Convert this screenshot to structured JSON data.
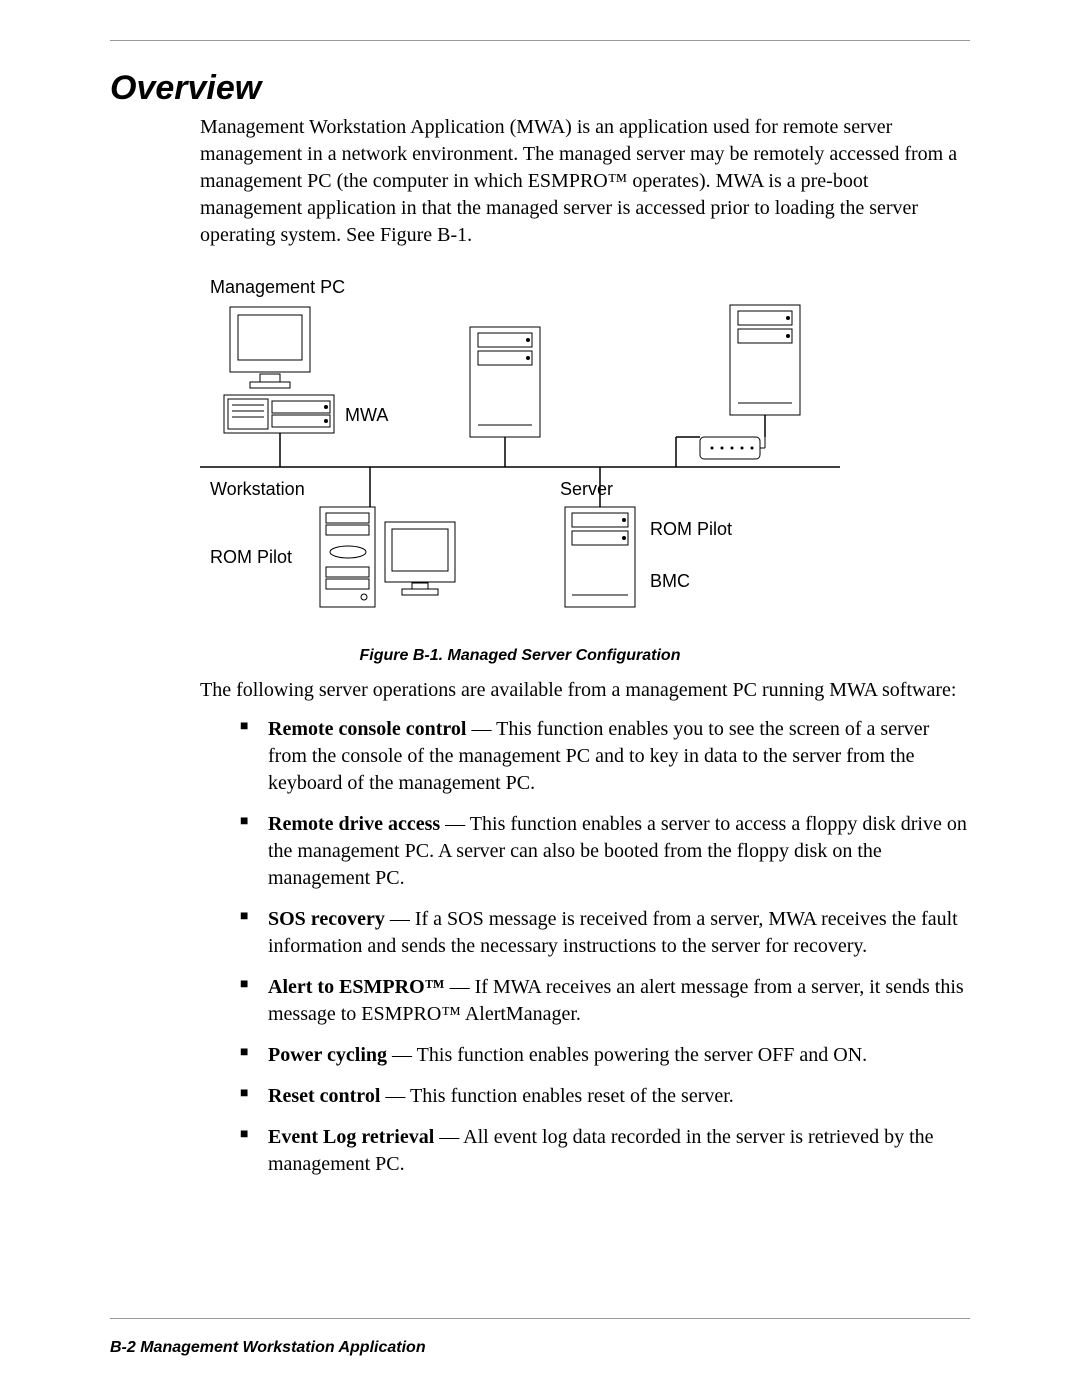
{
  "title": "Overview",
  "intro": "Management Workstation Application (MWA) is an application used for remote server management in a network environment. The managed server may be remotely accessed from a management PC (the computer in which ESMPRO™ operates). MWA is a pre-boot management application in that the managed server is accessed prior to loading the server operating system. See Figure B-1.",
  "diagram": {
    "mgmt_pc": "Management PC",
    "mwa": "MWA",
    "workstation": "Workstation",
    "server": "Server",
    "rom_pilot_left": "ROM Pilot",
    "rom_pilot_right": "ROM Pilot",
    "bmc": "BMC"
  },
  "figure_caption": "Figure B-1. Managed Server Configuration",
  "after_figure": "The following server operations are available from a management PC running MWA software:",
  "bullets": [
    {
      "term": "Remote console control",
      "desc": " — This function enables you to see the screen of a server from the console of the management PC and to key in data to the server from the keyboard of the management PC."
    },
    {
      "term": "Remote drive access",
      "desc": " — This function enables a server to access a floppy disk drive on the management PC. A server can also be booted from the floppy disk on the management PC."
    },
    {
      "term": "SOS recovery",
      "desc": " — If a SOS message is received from a server, MWA receives the fault information and sends the necessary instructions to the server for recovery."
    },
    {
      "term": "Alert to ESMPRO™",
      "desc": " — If MWA receives an alert message from a server, it sends this message to ESMPRO™ AlertManager."
    },
    {
      "term": "Power cycling",
      "desc": " — This function enables powering the server OFF and ON."
    },
    {
      "term": "Reset control",
      "desc": " — This function enables reset of the server."
    },
    {
      "term": "Event Log retrieval",
      "desc": " — All event log data recorded in the server is retrieved by the management PC."
    }
  ],
  "footer": "B-2   Management Workstation Application"
}
